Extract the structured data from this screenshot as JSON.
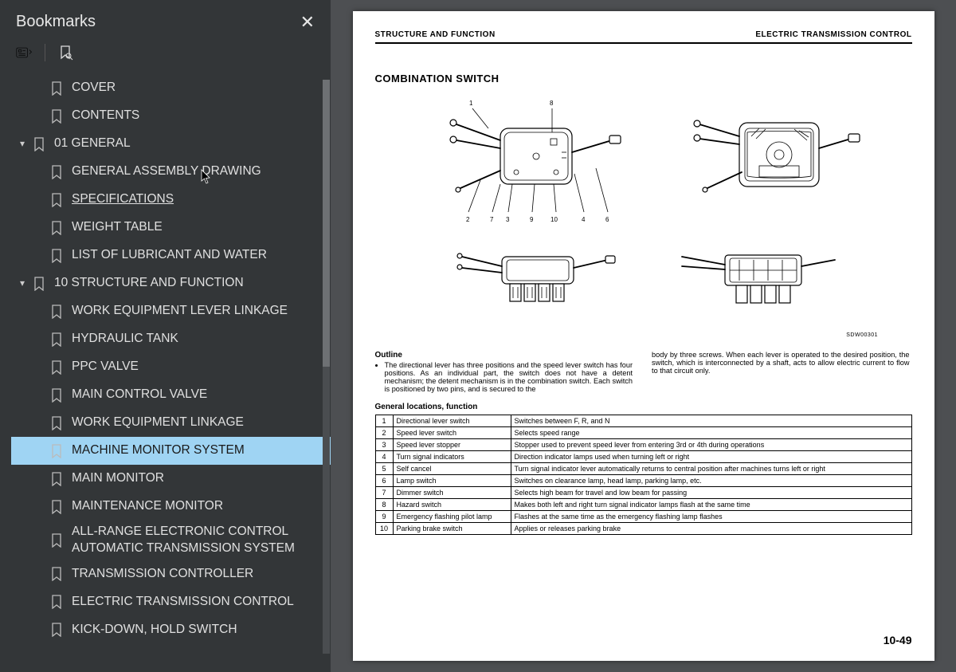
{
  "sidebar": {
    "title": "Bookmarks",
    "items": [
      {
        "label": "COVER",
        "level": 0,
        "chev": "",
        "selected": false
      },
      {
        "label": "CONTENTS",
        "level": 0,
        "chev": "",
        "selected": false
      },
      {
        "label": "01 GENERAL",
        "level": 0,
        "chev": "down",
        "selected": false
      },
      {
        "label": "GENERAL ASSEMBLY DRAWING",
        "level": 1,
        "chev": "",
        "selected": false
      },
      {
        "label": "SPECIFICATIONS",
        "level": 1,
        "chev": "",
        "selected": false,
        "underlined": true
      },
      {
        "label": "WEIGHT TABLE",
        "level": 1,
        "chev": "",
        "selected": false
      },
      {
        "label": "LIST OF LUBRICANT AND WATER",
        "level": 1,
        "chev": "",
        "selected": false
      },
      {
        "label": "10 STRUCTURE AND FUNCTION",
        "level": 0,
        "chev": "down",
        "selected": false
      },
      {
        "label": "WORK EQUIPMENT LEVER LINKAGE",
        "level": 1,
        "chev": "",
        "selected": false
      },
      {
        "label": "HYDRAULIC TANK",
        "level": 1,
        "chev": "",
        "selected": false
      },
      {
        "label": "PPC VALVE",
        "level": 1,
        "chev": "",
        "selected": false
      },
      {
        "label": "MAIN CONTROL VALVE",
        "level": 1,
        "chev": "",
        "selected": false
      },
      {
        "label": "WORK EQUIPMENT LINKAGE",
        "level": 1,
        "chev": "",
        "selected": false
      },
      {
        "label": "MACHINE MONITOR SYSTEM",
        "level": 1,
        "chev": "",
        "selected": true
      },
      {
        "label": "MAIN MONITOR",
        "level": 1,
        "chev": "",
        "selected": false
      },
      {
        "label": "MAINTENANCE MONITOR",
        "level": 1,
        "chev": "",
        "selected": false
      },
      {
        "label": "ALL-RANGE ELECTRONIC CONTROL AUTOMATIC TRANSMISSION SYSTEM",
        "level": 1,
        "chev": "",
        "selected": false
      },
      {
        "label": "TRANSMISSION CONTROLLER",
        "level": 1,
        "chev": "",
        "selected": false
      },
      {
        "label": "ELECTRIC TRANSMISSION CONTROL",
        "level": 1,
        "chev": "",
        "selected": false
      },
      {
        "label": "KICK-DOWN, HOLD SWITCH",
        "level": 1,
        "chev": "",
        "selected": false
      }
    ]
  },
  "page": {
    "header_left": "STRUCTURE AND FUNCTION",
    "header_right": "ELECTRIC TRANSMISSION CONTROL",
    "section_title": "COMBINATION SWITCH",
    "image_id": "SDW00301",
    "outline_head": "Outline",
    "outline_left": "The directional lever has three positions and the speed lever switch has four positions. As an individual part, the switch does not have a detent mechanism; the detent mechanism is in the combination switch. Each switch is positioned by two pins, and is secured to the",
    "outline_right": "body by three screws. When each lever is operated to the desired position, the switch, which is interconnected by a shaft, acts to allow electric current to flow to that circuit only.",
    "general_head": "General locations, function",
    "table": [
      {
        "n": "1",
        "name": "Directional lever switch",
        "func": "Switches between F, R, and N"
      },
      {
        "n": "2",
        "name": "Speed lever switch",
        "func": "Selects speed range"
      },
      {
        "n": "3",
        "name": "Speed lever stopper",
        "func": "Stopper used to prevent speed lever from entering 3rd or 4th during operations"
      },
      {
        "n": "4",
        "name": "Turn signal indicators",
        "func": "Direction indicator lamps used when turning left or right"
      },
      {
        "n": "5",
        "name": "Self cancel",
        "func": "Turn signal indicator lever automatically returns to central position after machines turns left or right"
      },
      {
        "n": "6",
        "name": "Lamp switch",
        "func": "Switches on clearance lamp, head lamp, parking lamp, etc."
      },
      {
        "n": "7",
        "name": "Dimmer switch",
        "func": "Selects high beam for travel and low beam for passing"
      },
      {
        "n": "8",
        "name": "Hazard switch",
        "func": "Makes both left and right turn signal indicator lamps flash at the same time"
      },
      {
        "n": "9",
        "name": "Emergency flashing pilot lamp",
        "func": "Flashes at the same time as the emergency flashing lamp flashes"
      },
      {
        "n": "10",
        "name": "Parking brake switch",
        "func": "Applies or releases parking brake"
      }
    ],
    "page_number": "10-49",
    "callouts": {
      "top": [
        "1",
        "8"
      ],
      "bottom": [
        "2",
        "7",
        "3",
        "9",
        "10",
        "4",
        "6"
      ]
    }
  }
}
